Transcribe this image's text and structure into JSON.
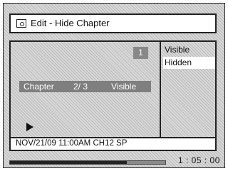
{
  "window": {
    "title": "Edit - Hide Chapter",
    "icon": "disc-edit-icon"
  },
  "preview": {
    "chapter_badge": "1",
    "chapter_label": "Chapter",
    "chapter_count": "2/ 3",
    "chapter_status": "Visible",
    "play_icon": "play-icon"
  },
  "menu": {
    "items": [
      {
        "label": "Visible",
        "selected": false
      },
      {
        "label": "Hidden",
        "selected": true
      }
    ]
  },
  "footer": {
    "info": "NOV/21/09 11:00AM CH12 SP"
  },
  "playback": {
    "time": "1 : 05 : 00",
    "progress": 0.75
  },
  "colors": {
    "background_pattern": "#dadada",
    "badge": "#888888",
    "chapter_bar": "#7f7f7f",
    "selected_item": "#ffffff"
  }
}
